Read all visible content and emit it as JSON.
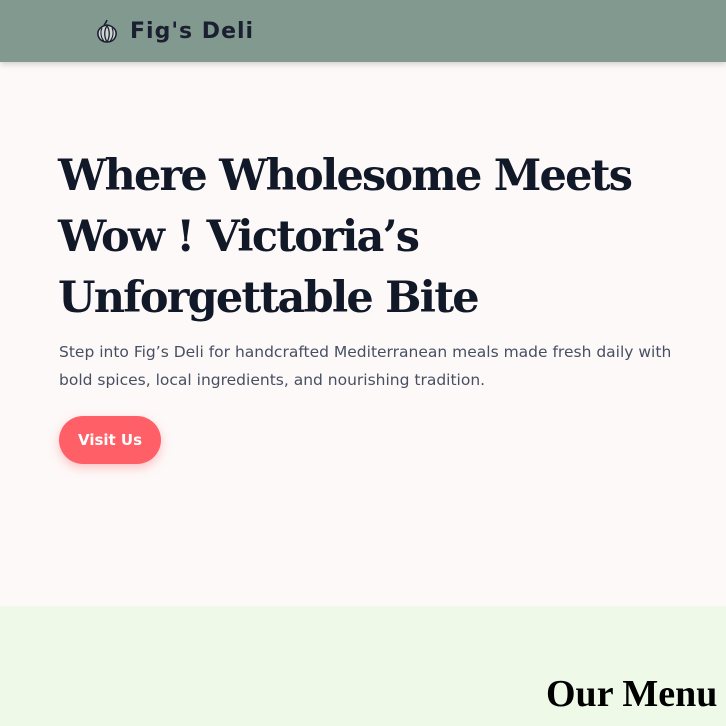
{
  "nav": {
    "brand_icon": "garlic-icon",
    "brand_name": "Fig's Deli"
  },
  "hero": {
    "title": "Where Wholesome Meets Wow ! Victoria’s Unforgettable Bite",
    "description": "Step into Fig’s Deli for handcrafted Mediterranean meals made fresh daily with bold spices, local ingredients, and nourishing tradition.",
    "cta_label": "Visit Us"
  },
  "menu": {
    "heading": "Our Menu"
  },
  "colors": {
    "navbar": "#82998f",
    "hero_background": "#fdf9f8",
    "cta": "#ff5f66",
    "menu_background": "#eef9e8",
    "heading_text": "#111827"
  }
}
